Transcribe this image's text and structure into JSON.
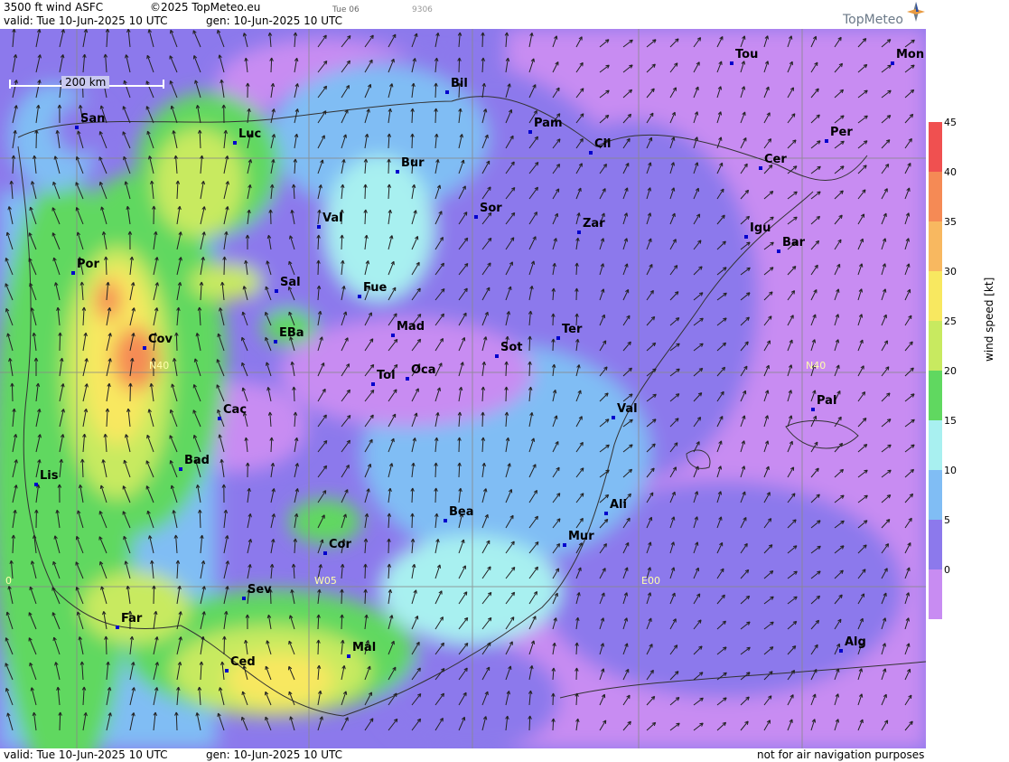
{
  "header": {
    "product": "3500 ft wind ASFC",
    "copyright": "©2025 TopMeteo.eu",
    "day": "Tue 06",
    "code": "9306",
    "valid": "valid:  Tue  10-Jun-2025  10 UTC",
    "gen": "gen: 10-Jun-2025 10 UTC",
    "brand": "TopMeteo"
  },
  "footer": {
    "valid": "valid:  Tue  10-Jun-2025  10 UTC",
    "gen": "gen: 10-Jun-2025 10 UTC",
    "disclaimer": "not for air navigation purposes"
  },
  "scale_label": "200 km",
  "legend": {
    "unit": "wind speed  [kt]",
    "ticks": [
      "45",
      "40",
      "35",
      "30",
      "25",
      "20",
      "15",
      "10",
      "5",
      "0"
    ],
    "colors": [
      "#f05050",
      "#f58a55",
      "#f8b860",
      "#f8e860",
      "#c8ea60",
      "#60d860",
      "#a8f0f0",
      "#80bdf4",
      "#8c79ec",
      "#c88cf2"
    ]
  },
  "grid_labels": {
    "n40_west": "N40",
    "n40_east": "N40",
    "w05": "W05",
    "e00": "E00",
    "zero": "0"
  },
  "cities": [
    {
      "name": "Bil"
    },
    {
      "name": "Tou"
    },
    {
      "name": "Mon"
    },
    {
      "name": "San"
    },
    {
      "name": "Luc"
    },
    {
      "name": "Pam"
    },
    {
      "name": "Cil"
    },
    {
      "name": "Per"
    },
    {
      "name": "Bur"
    },
    {
      "name": "Cer"
    },
    {
      "name": "Sor"
    },
    {
      "name": "Val"
    },
    {
      "name": "Zar"
    },
    {
      "name": "Igu"
    },
    {
      "name": "Bar"
    },
    {
      "name": "Por"
    },
    {
      "name": "Sal"
    },
    {
      "name": "Fue"
    },
    {
      "name": "Mad"
    },
    {
      "name": "EBa"
    },
    {
      "name": "Ter"
    },
    {
      "name": "Cov"
    },
    {
      "name": "Sot"
    },
    {
      "name": "Tol"
    },
    {
      "name": "Oca"
    },
    {
      "name": "Pal"
    },
    {
      "name": "Cac"
    },
    {
      "name": "Val"
    },
    {
      "name": "Bad"
    },
    {
      "name": "Lis"
    },
    {
      "name": "Ali"
    },
    {
      "name": "Bea"
    },
    {
      "name": "Mur"
    },
    {
      "name": "Cor"
    },
    {
      "name": "Sev"
    },
    {
      "name": "Far"
    },
    {
      "name": "Mal"
    },
    {
      "name": "Alg"
    },
    {
      "name": "Ced"
    }
  ]
}
